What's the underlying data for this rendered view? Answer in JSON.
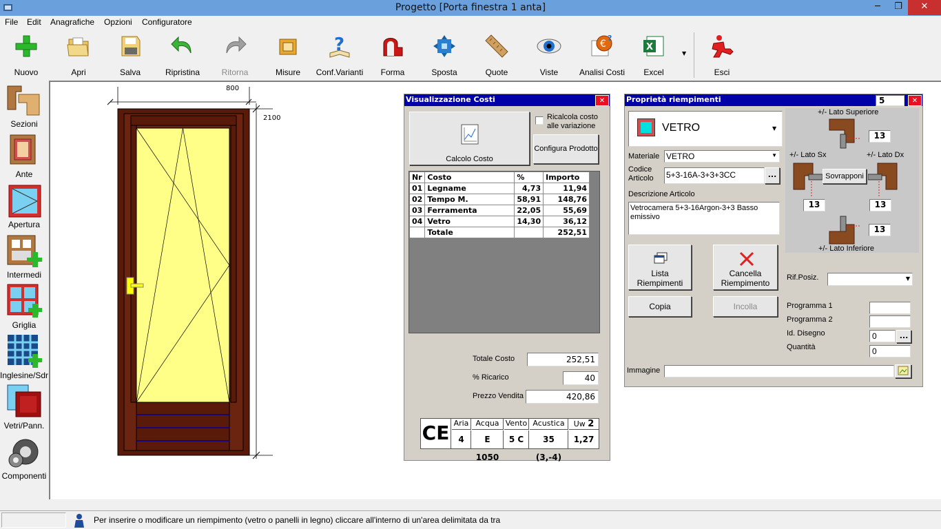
{
  "window": {
    "title": "Progetto [Porta finestra 1 anta]",
    "min": "─",
    "max": "❐",
    "close": "✕"
  },
  "menu": [
    {
      "label": "File"
    },
    {
      "label": "Edit"
    },
    {
      "label": "Anagrafiche"
    },
    {
      "label": "Opzioni"
    },
    {
      "label": "Configuratore"
    }
  ],
  "toolbar": {
    "nuovo": "Nuovo",
    "apri": "Apri",
    "salva": "Salva",
    "ripristina": "Ripristina",
    "ritorna": "Ritorna",
    "misure": "Misure",
    "conf_varianti": "Conf.Varianti",
    "forma": "Forma",
    "sposta": "Sposta",
    "quote": "Quote",
    "viste": "Viste",
    "analisi_costi": "Analisi Costi",
    "excel": "Excel",
    "esci": "Esci"
  },
  "sidebar": {
    "sezioni": "Sezioni",
    "ante": "Ante",
    "apertura": "Apertura",
    "intermedi": "Intermedi",
    "griglia": "Griglia",
    "inglesine": "Inglesine/Sdr",
    "vetri": "Vetri/Pann.",
    "componenti": "Componenti"
  },
  "drawing": {
    "width_dim": "800",
    "height_dim": "2100"
  },
  "costs": {
    "title": "Visualizzazione Costi",
    "calc_label": "Calcolo Costo",
    "recalc_label": "Ricalcola costo alle variazione",
    "recalc_checked": false,
    "configure_label": "Configura Prodotto",
    "headers": {
      "nr": "Nr",
      "costo": "Costo",
      "pct": "%",
      "importo": "Importo"
    },
    "rows": [
      {
        "nr": "01",
        "costo": "Legname",
        "pct": "4,73",
        "importo": "11,94"
      },
      {
        "nr": "02",
        "costo": "Tempo M.",
        "pct": "58,91",
        "importo": "148,76"
      },
      {
        "nr": "03",
        "costo": "Ferramenta",
        "pct": "22,05",
        "importo": "55,69"
      },
      {
        "nr": "04",
        "costo": "Vetro",
        "pct": "14,30",
        "importo": "36,12"
      }
    ],
    "total_row": {
      "label": "Totale",
      "importo": "252,51"
    },
    "totale_costo_label": "Totale Costo",
    "totale_costo": "252,51",
    "ricarico_label": "% Ricarico",
    "ricarico": "40",
    "prezzo_label": "Prezzo Vendita",
    "prezzo": "420,86",
    "ce": {
      "mark": "CE",
      "headers": {
        "aria": "Aria",
        "acqua": "Acqua",
        "vento": "Vento",
        "acustica": "Acustica",
        "uw": "Uw"
      },
      "values": {
        "aria": "4",
        "acqua": "E 1050",
        "vento": "5 C",
        "acustica": "35 (3,-4)",
        "uw": "1,27"
      },
      "uw_badge": "2"
    }
  },
  "props": {
    "title": "Proprietà riempimenti",
    "index": "5",
    "type_selected": "VETRO",
    "materiale_label": "Materiale",
    "materiale": "VETRO",
    "codice_label": "Codice Articolo",
    "codice": "5+3-16A-3+3+3CC",
    "descr_label": "Descrizione Articolo",
    "descr": "Vetrocamera 5+3-16Argon-3+3 Basso emissivo",
    "lato_sup": "+/- Lato Superiore",
    "lato_sx": "+/- Lato Sx",
    "lato_dx": "+/- Lato Dx",
    "lato_inf": "+/- Lato Inferiore",
    "val_sup": "13",
    "val_sx": "13",
    "val_dx": "13",
    "val_inf": "13",
    "sovrapponi": "Sovrapponi",
    "lista_label": "Lista Riempimenti",
    "cancella_label": "Cancella Riempimento",
    "copia": "Copia",
    "incolla": "Incolla",
    "rif_label": "Rif.Posiz.",
    "rif": "",
    "prog1_label": "Programma 1",
    "prog1": "",
    "prog2_label": "Programma 2",
    "prog2": "",
    "disegno_label": "Id. Disegno",
    "disegno": "0",
    "quantita_label": "Quantità",
    "quantita": "0",
    "immagine_label": "Immagine",
    "immagine": "",
    "browse": "..."
  },
  "status": {
    "message": "Per inserire o modificare un riempimento (vetro o panelli in legno) cliccare all'interno di un'area delimitata da tra"
  },
  "colors": {
    "frame": "#5a1a0a",
    "glass": "#ffff88",
    "panel_title": "#0000a8",
    "close": "#e81123"
  }
}
